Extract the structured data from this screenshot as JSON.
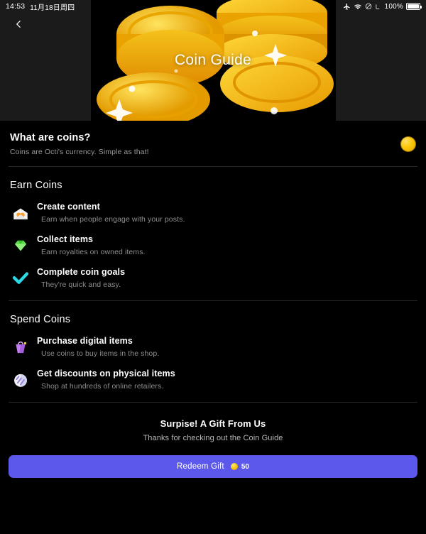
{
  "statusbar": {
    "time": "14:53",
    "date": "11月18日周四",
    "battery_pct": "100%",
    "icons": [
      "airplane-icon",
      "wifi-icon",
      "mute-icon",
      "call-icon"
    ]
  },
  "header": {
    "back_icon": "chevron-left-icon",
    "title": "Coin Guide",
    "art": "gold-coin-pile-illustration"
  },
  "intro": {
    "title": "What are coins?",
    "subtitle": "Coins are Octi's currency. Simple as that!",
    "badge_icon": "gold-coin-icon"
  },
  "earn": {
    "title": "Earn Coins",
    "items": [
      {
        "icon": "love-letter-icon",
        "title": "Create content",
        "desc": "Earn when people engage with your posts."
      },
      {
        "icon": "gem-stone-icon",
        "title": "Collect items",
        "desc": "Earn royalties on owned items."
      },
      {
        "icon": "check-mark-icon",
        "title": "Complete coin goals",
        "desc": "They're quick and easy."
      }
    ]
  },
  "spend": {
    "title": "Spend Coins",
    "items": [
      {
        "icon": "shopping-bag-icon",
        "title": "Purchase digital items",
        "desc": "Use coins to buy items in the shop."
      },
      {
        "icon": "disco-ball-icon",
        "title": "Get discounts on physical items",
        "desc": "Shop at hundreds of online retailers."
      }
    ]
  },
  "gift": {
    "title": "Surpise! A Gift From Us",
    "subtitle": "Thanks for checking out the Coin Guide",
    "button_label": "Redeem Gift",
    "button_amount": "50",
    "button_coin_icon": "coin-icon"
  },
  "colors": {
    "background": "#000000",
    "header_bg": "#1b1b1b",
    "accent": "#5b58eb",
    "coin_gold": "#f6c400",
    "muted_text": "#8e8e8e"
  }
}
